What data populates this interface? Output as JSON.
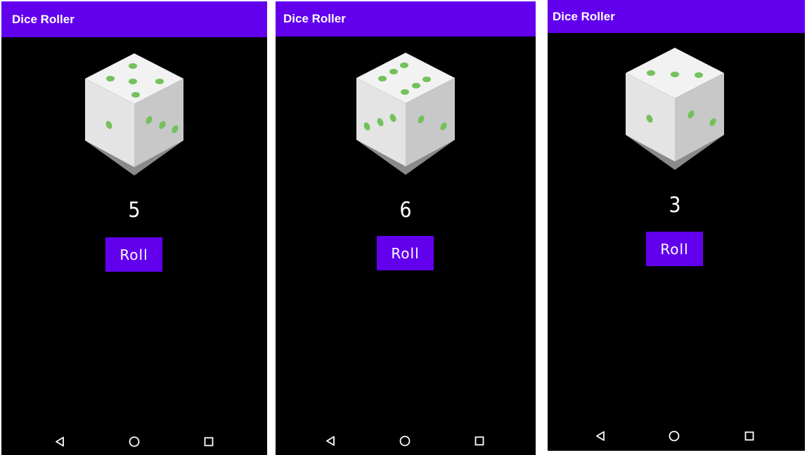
{
  "screens": [
    {
      "app_title": "Dice Roller",
      "result": "5",
      "roll_label": "Roll"
    },
    {
      "app_title": "Dice Roller",
      "result": "6",
      "roll_label": "Roll"
    },
    {
      "app_title": "Dice Roller",
      "result": "3",
      "roll_label": "Roll"
    }
  ],
  "colors": {
    "app_bar": "#6200ee",
    "button": "#6200ee",
    "background": "#000000",
    "pip": "#74c15c",
    "die_top": "#f2f2f2",
    "die_left": "#e4e4e4",
    "die_right": "#c8c8c8",
    "die_shadow": "#8a8a8a"
  },
  "navigation": {
    "back": "back-triangle-icon",
    "home": "home-circle-icon",
    "recents": "recents-square-icon"
  }
}
